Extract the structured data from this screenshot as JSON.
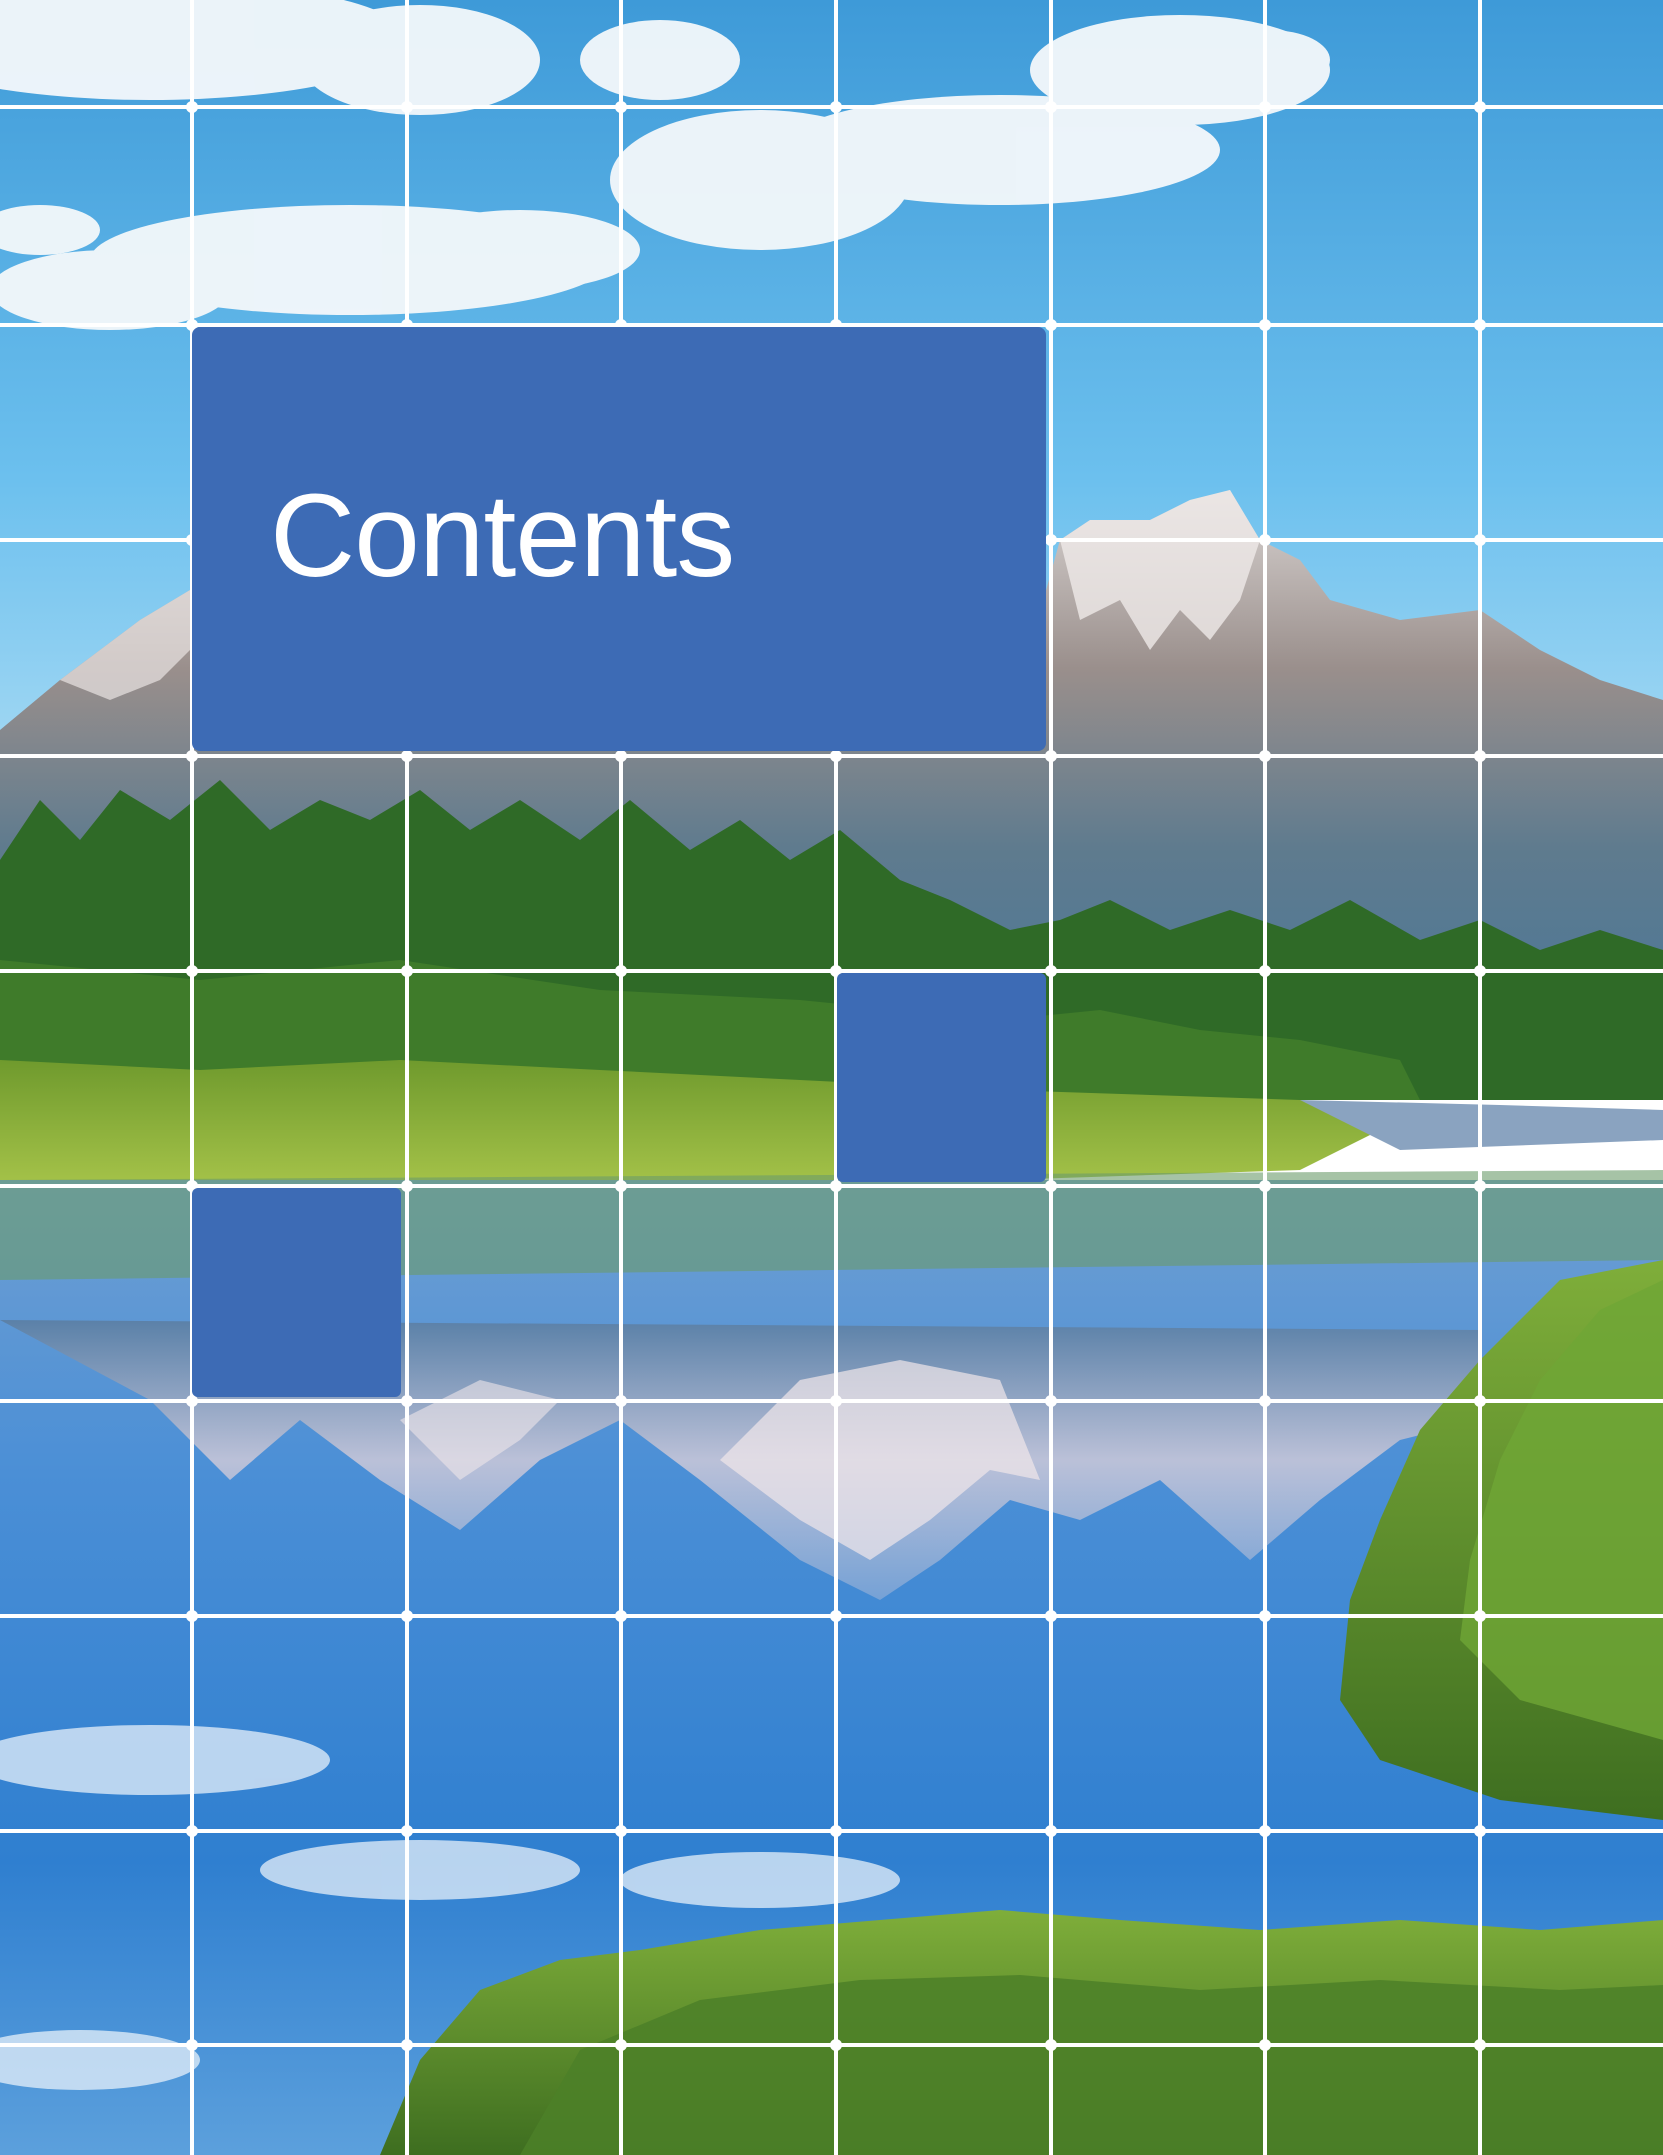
{
  "page": {
    "title": "Contents"
  },
  "background": {
    "photo": "mountain-lake-reflection",
    "colors": {
      "brand_blue": "#3d6bb5",
      "grid_lines": "#ffffff"
    }
  }
}
